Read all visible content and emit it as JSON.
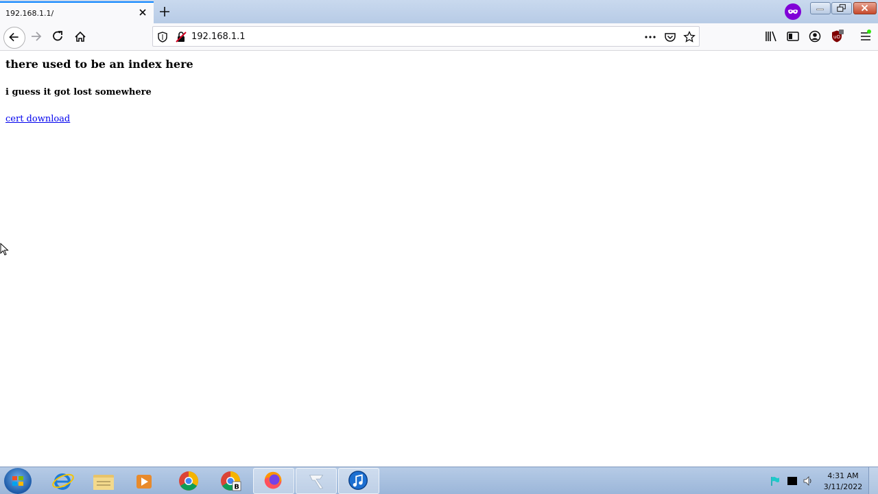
{
  "browser": {
    "tab": {
      "title": "192.168.1.1/"
    },
    "url": "192.168.1.1"
  },
  "page": {
    "heading": "there used to be an index here",
    "subheading": "i guess it got lost somewhere",
    "link_text": "cert download"
  },
  "taskbar": {
    "apps": [
      "internet-explorer",
      "file-explorer",
      "media-player",
      "chrome",
      "chrome-profile",
      "firefox",
      "pinned-app",
      "itunes"
    ],
    "clock_time": "4:31 AM",
    "clock_date": "3/11/2022"
  },
  "colors": {
    "accent": "#0a84ff",
    "link": "#0000ee",
    "private_badge": "#8000d7"
  }
}
